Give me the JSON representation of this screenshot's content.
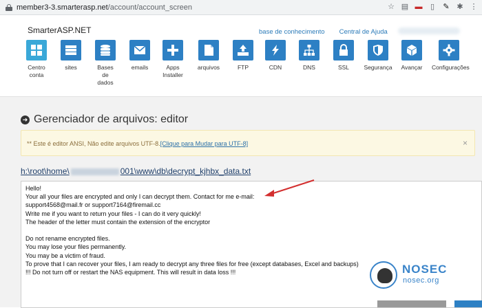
{
  "browser": {
    "url_host": "member3-3.smarterasp.net",
    "url_path": "/account/account_screen",
    "icons": [
      "star-icon",
      "extension-icon",
      "mail-icon",
      "reader-icon",
      "pen-icon",
      "puzzle-icon",
      "menu-icon"
    ]
  },
  "header": {
    "brand": "SmarterASP.NET",
    "links": [
      "base de conhecimento",
      "Central de Ajuda"
    ],
    "tiles": [
      {
        "label": "Centro\nconta",
        "icon": "grid-icon"
      },
      {
        "label": "sites",
        "icon": "server-icon"
      },
      {
        "label": "Bases\nde\ndados",
        "icon": "database-icon"
      },
      {
        "label": "emails",
        "icon": "envelope-icon"
      },
      {
        "label": "Apps\nInstaller",
        "icon": "plus-icon"
      },
      {
        "label": "arquivos",
        "icon": "file-icon"
      },
      {
        "label": "FTP",
        "icon": "upload-icon"
      },
      {
        "label": "CDN",
        "icon": "bolt-icon"
      },
      {
        "label": "DNS",
        "icon": "sitemap-icon"
      },
      {
        "label": "SSL",
        "icon": "lock-icon"
      },
      {
        "label": "Segurança",
        "icon": "shield-icon"
      },
      {
        "label": "Avançar",
        "icon": "cube-icon"
      },
      {
        "label": "Configurações",
        "icon": "gear-icon"
      }
    ]
  },
  "page": {
    "title": "Gerenciador de arquivos: editor",
    "alert_text": "** Este é editor ANSI, Não edite arquivos UTF-8.",
    "alert_link": "[Clique para Mudar para UTF-8]",
    "alert_close": "×",
    "path_prefix": "h:\\root\\home\\",
    "path_suffix": "001\\www\\db\\decrypt_kjhbx_data.txt"
  },
  "editor": {
    "lines": [
      "Hello!",
      "Your all your files are encrypted and only I can decrypt them. Contact for me e-mail:",
      "support4568@mail.fr or support7164@firemail.cc",
      "Write me if you want to return your files - I can do it very quickly!",
      "The header of the letter must contain the extension of the encryptor",
      "",
      "Do not rename encrypted files.",
      "You may lose your files permanently.",
      "You may be a victim of fraud.",
      "To prove that I can recover your files, I am ready to decrypt any three files for free (except databases, Excel and backups)",
      "!!! Do not turn off or restart the NAS equipment. This will result in data loss !!!"
    ]
  },
  "watermark": {
    "name": "NOSEC",
    "domain": "nosec.org",
    "color": "#3a84c9"
  },
  "colors": {
    "tile_blue": "#2d80c4",
    "tile_first": "#3aa8d8",
    "link_blue": "#2a7ab8",
    "alert_bg": "#fcf8e3"
  }
}
